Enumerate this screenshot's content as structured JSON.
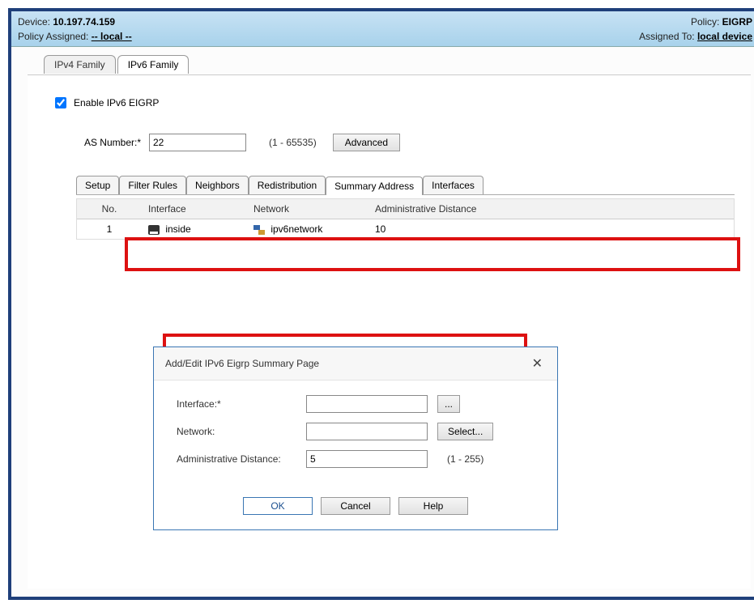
{
  "header": {
    "device_label": "Device: ",
    "device_value": "10.197.74.159",
    "policy_assigned_label": "Policy Assigned: ",
    "policy_assigned_value": "-- local --",
    "policy_label": "Policy: ",
    "policy_value": "EIGRP",
    "assigned_to_label": "Assigned To: ",
    "assigned_to_value": "local device"
  },
  "main_tabs": {
    "ipv4": "IPv4 Family",
    "ipv6": "IPv6 Family"
  },
  "ipv6_panel": {
    "enable_label": "Enable IPv6 EIGRP",
    "enable_checked": true,
    "as_label": "AS Number:*",
    "as_value": "22",
    "as_range": "(1 - 65535)",
    "advanced_btn": "Advanced"
  },
  "sub_tabs": [
    "Setup",
    "Filter Rules",
    "Neighbors",
    "Redistribution",
    "Summary Address",
    "Interfaces"
  ],
  "sub_tab_active_index": 4,
  "table": {
    "headers": {
      "no": "No.",
      "iface": "Interface",
      "network": "Network",
      "admin": "Administrative Distance"
    },
    "rows": [
      {
        "no": "1",
        "iface": "inside",
        "network": "ipv6network",
        "admin": "10"
      }
    ]
  },
  "dialog": {
    "title": "Add/Edit IPv6 Eigrp Summary Page",
    "interface_label": "Interface:*",
    "interface_value": "",
    "browse": "...",
    "network_label": "Network:",
    "network_value": "",
    "select_btn": "Select...",
    "admin_label": "Administrative Distance:",
    "admin_value": "5",
    "admin_range": "(1 - 255)",
    "ok": "OK",
    "cancel": "Cancel",
    "help": "Help"
  }
}
